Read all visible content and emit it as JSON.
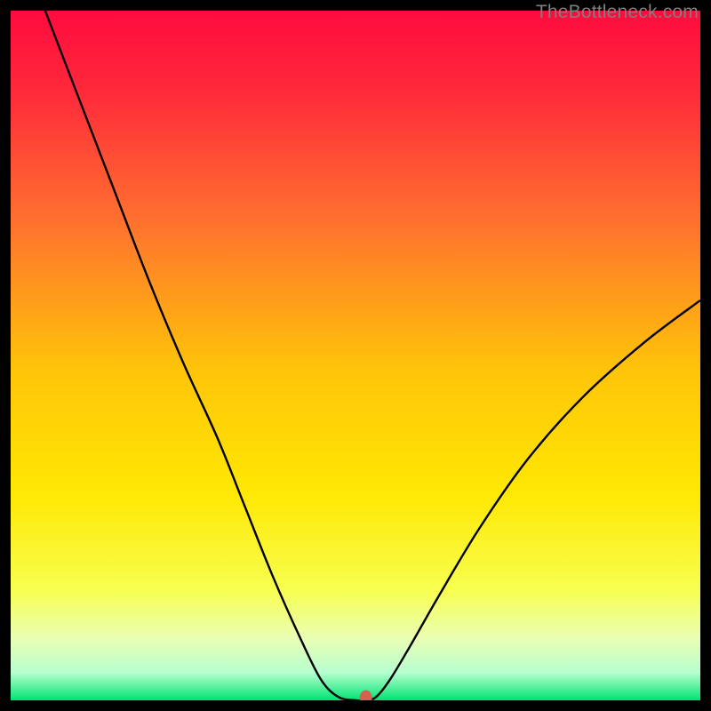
{
  "watermark": "TheBottleneck.com",
  "chart_data": {
    "type": "line",
    "title": "",
    "xlabel": "",
    "ylabel": "",
    "xlim": [
      0,
      100
    ],
    "ylim": [
      0,
      100
    ],
    "background_gradient": {
      "stops": [
        {
          "pct": 0,
          "color": "#ff0b3e"
        },
        {
          "pct": 12,
          "color": "#ff2a3a"
        },
        {
          "pct": 30,
          "color": "#ff6f2f"
        },
        {
          "pct": 52,
          "color": "#ffc409"
        },
        {
          "pct": 70,
          "color": "#ffe803"
        },
        {
          "pct": 84,
          "color": "#f7ff50"
        },
        {
          "pct": 91,
          "color": "#eaffb4"
        },
        {
          "pct": 96,
          "color": "#b6ffcf"
        },
        {
          "pct": 100,
          "color": "#00e371"
        }
      ]
    },
    "series": [
      {
        "name": "bottleneck-curve",
        "stroke": "#000000",
        "stroke_width": 2.4,
        "points": [
          {
            "x": 5.0,
            "y": 100.0
          },
          {
            "x": 10.0,
            "y": 87.0
          },
          {
            "x": 15.0,
            "y": 74.0
          },
          {
            "x": 20.0,
            "y": 61.0
          },
          {
            "x": 25.0,
            "y": 49.0
          },
          {
            "x": 30.0,
            "y": 38.0
          },
          {
            "x": 34.0,
            "y": 28.0
          },
          {
            "x": 38.0,
            "y": 18.0
          },
          {
            "x": 42.0,
            "y": 9.0
          },
          {
            "x": 45.0,
            "y": 3.0
          },
          {
            "x": 47.5,
            "y": 0.5
          },
          {
            "x": 50.0,
            "y": 0.0
          },
          {
            "x": 51.5,
            "y": 0.0
          },
          {
            "x": 53.0,
            "y": 0.5
          },
          {
            "x": 55.0,
            "y": 3.0
          },
          {
            "x": 58.0,
            "y": 8.0
          },
          {
            "x": 62.0,
            "y": 15.0
          },
          {
            "x": 68.0,
            "y": 25.0
          },
          {
            "x": 75.0,
            "y": 35.0
          },
          {
            "x": 83.0,
            "y": 44.0
          },
          {
            "x": 92.0,
            "y": 52.0
          },
          {
            "x": 100.0,
            "y": 58.0
          }
        ]
      }
    ],
    "marker": {
      "x": 51.5,
      "y": 0.3,
      "color": "#d6604d",
      "rx": 7,
      "ry": 9
    }
  }
}
